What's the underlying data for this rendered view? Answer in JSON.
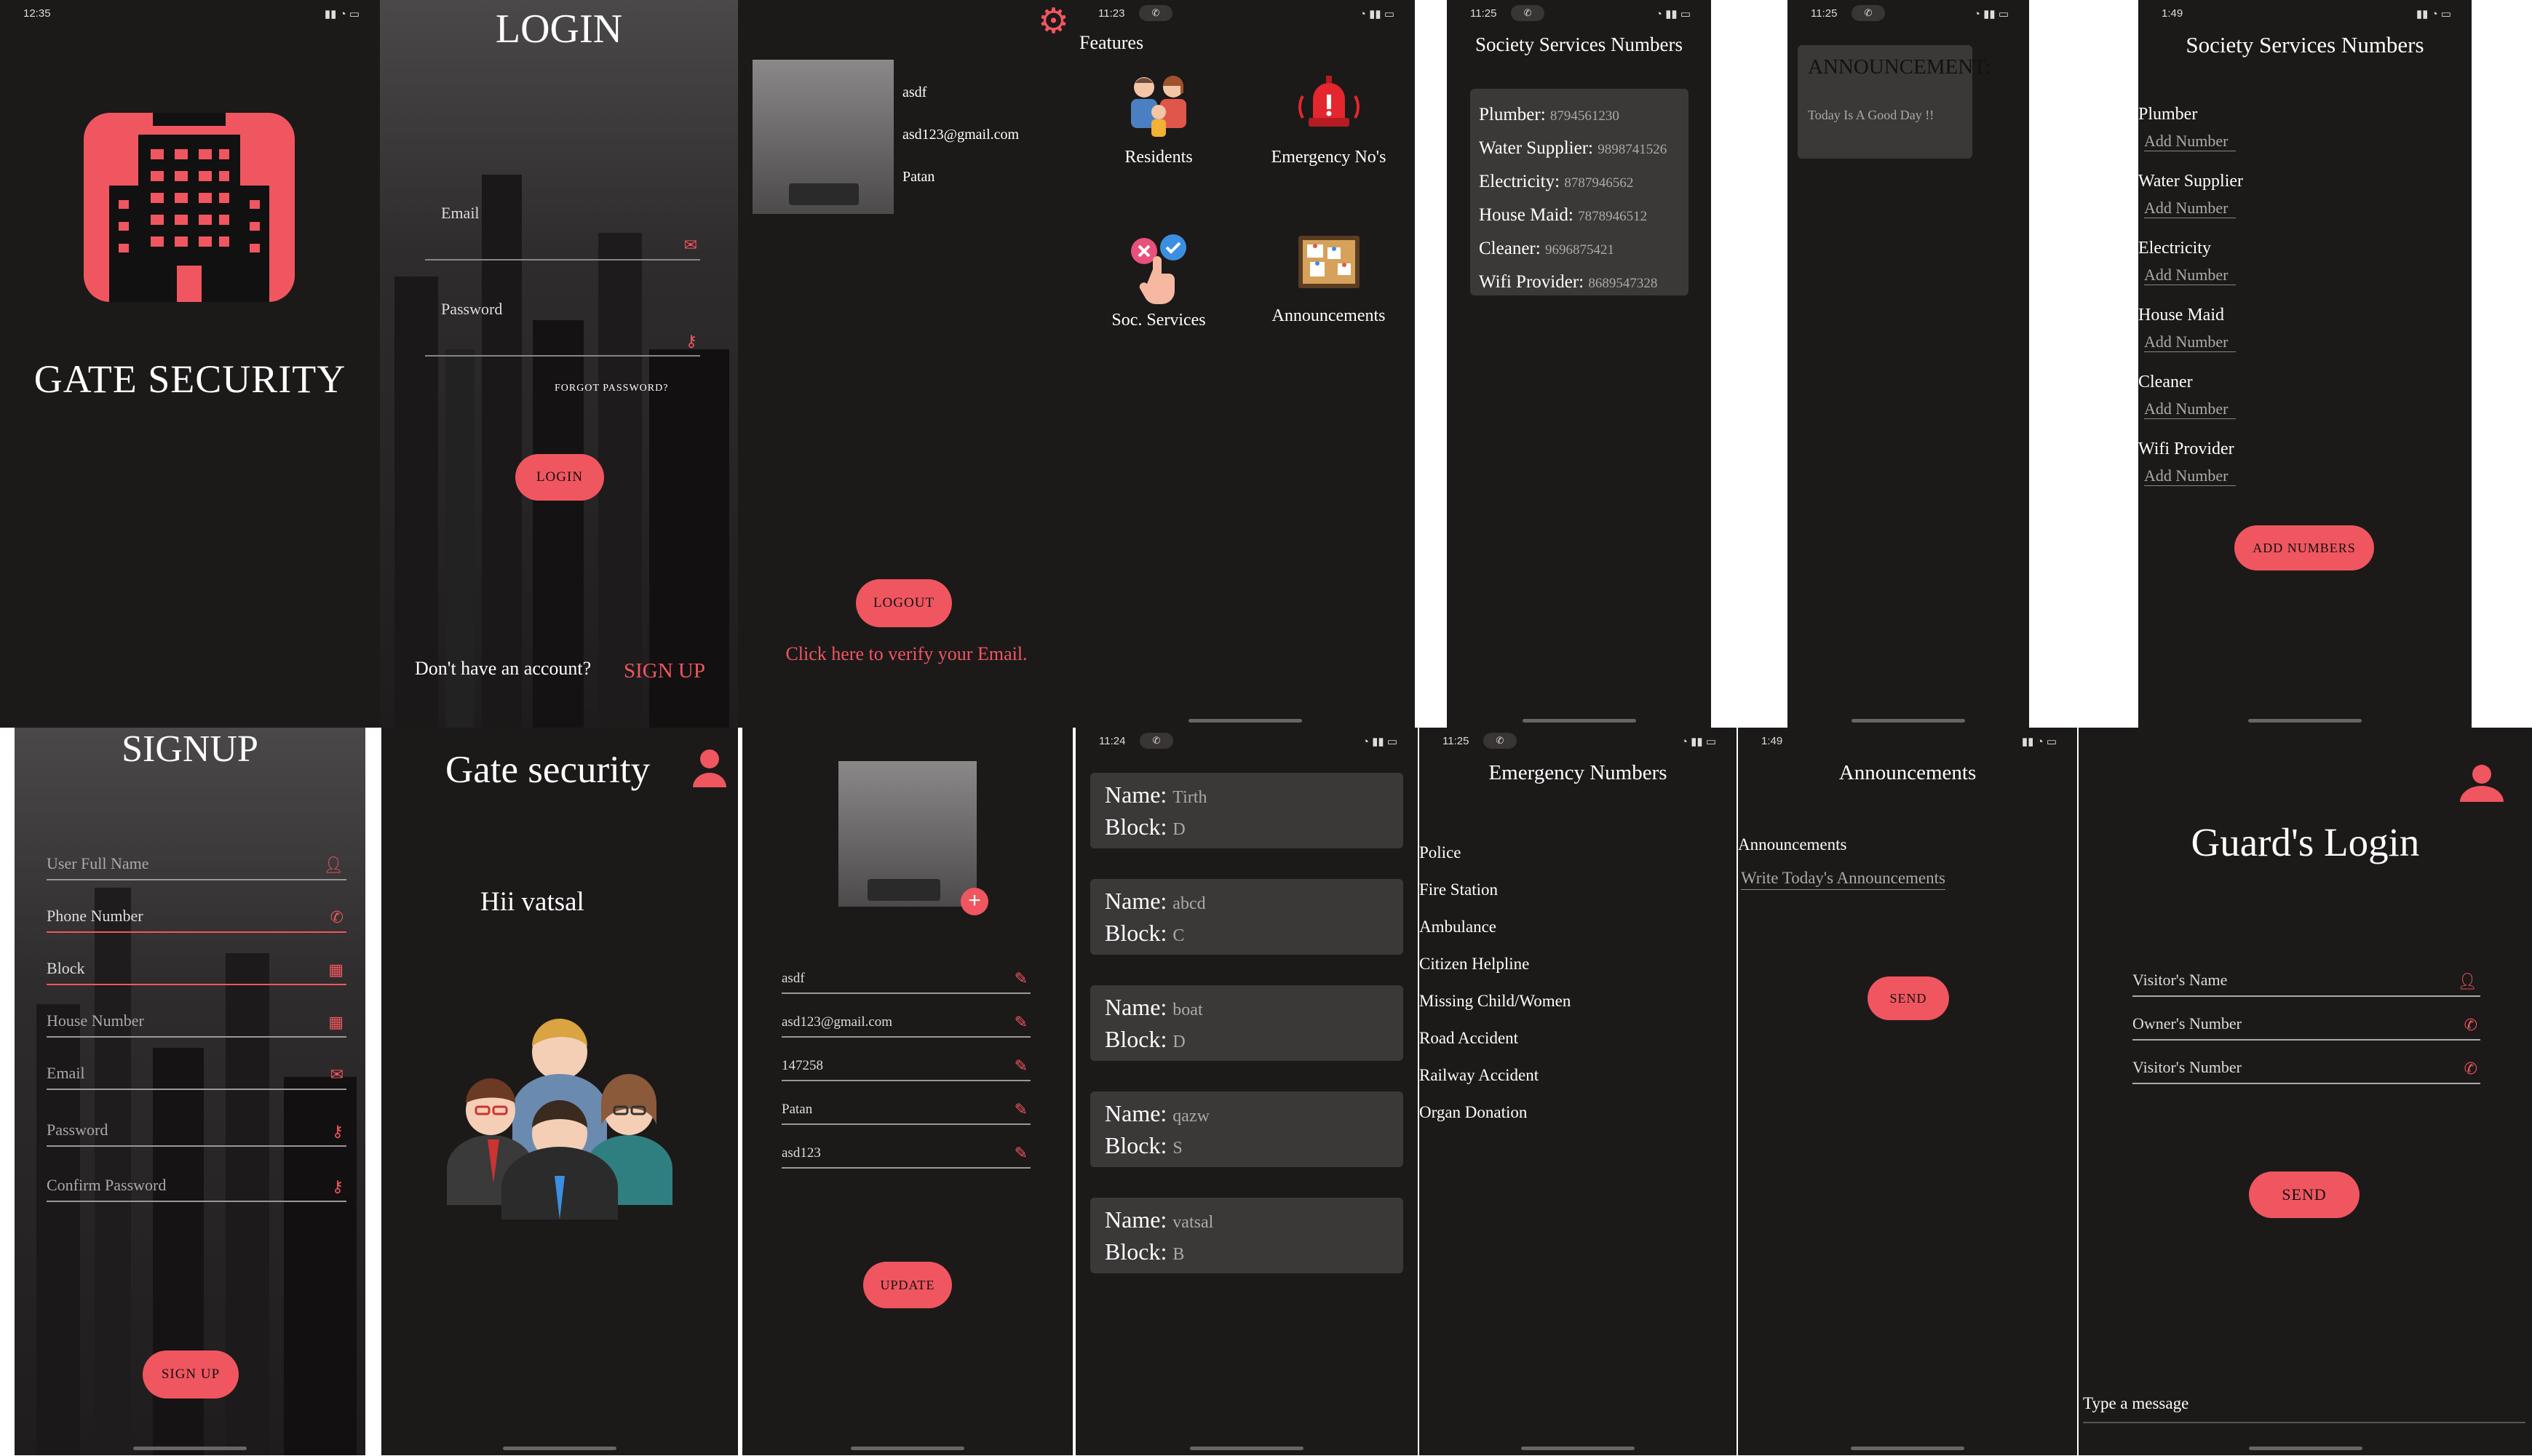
{
  "colors": {
    "accent": "#f05660",
    "panel_bg": "#1c1919",
    "card_bg": "#3b3838"
  },
  "splash": {
    "time": "12:35",
    "title": "GATE SECURITY",
    "logo_icon": "building-icon"
  },
  "login": {
    "title": "LOGIN",
    "email_label": "Email",
    "password_label": "Password",
    "forgot": "FORGOT PASSWORD?",
    "button": "LOGIN",
    "no_account": "Don't have an account?",
    "signup_link": "SIGN UP"
  },
  "profile": {
    "name": "asdf",
    "email": "asd123@gmail.com",
    "city": "Patan",
    "logout": "LOGOUT",
    "verify": "Click here to verify your Email."
  },
  "features": {
    "time": "11:23",
    "header": "Features",
    "items": [
      {
        "label": "Residents",
        "icon": "family-icon"
      },
      {
        "label": "Emergency No's",
        "icon": "alarm-icon"
      },
      {
        "label": "Soc. Services",
        "icon": "choice-icon"
      },
      {
        "label": "Announcements",
        "icon": "board-icon"
      }
    ]
  },
  "services_view": {
    "time": "11:25",
    "title": "Society Services Numbers",
    "rows": [
      {
        "label": "Plumber:",
        "value": "8794561230"
      },
      {
        "label": "Water Supplier:",
        "value": "9898741526"
      },
      {
        "label": "Electricity:",
        "value": "8787946562"
      },
      {
        "label": "House Maid:",
        "value": "7878946512"
      },
      {
        "label": "Cleaner:",
        "value": "9696875421"
      },
      {
        "label": "Wifi Provider:",
        "value": "8689547328"
      }
    ]
  },
  "announcement_view": {
    "time": "11:25",
    "title": "ANNOUNCEMENT:",
    "text": "Today Is A Good Day !!"
  },
  "services_edit": {
    "time": "1:49",
    "title": "Society Services Numbers",
    "items": [
      "Plumber",
      "Water Supplier",
      "Electricity",
      "House Maid",
      "Cleaner",
      "Wifi Provider"
    ],
    "placeholder": "Add Number",
    "button": "ADD NUMBERS"
  },
  "signup": {
    "title": "SIGNUP",
    "fields": [
      {
        "label": "User Full Name",
        "icon": "person-icon"
      },
      {
        "label": "Phone Number",
        "icon": "phone-icon"
      },
      {
        "label": "Block",
        "icon": "building-small-icon"
      },
      {
        "label": "House Number",
        "icon": "building-small-icon"
      },
      {
        "label": "Email",
        "icon": "mail-icon"
      },
      {
        "label": "Password",
        "icon": "key-icon"
      },
      {
        "label": "Confirm Password",
        "icon": "key-icon"
      }
    ],
    "button": "SIGN UP"
  },
  "home": {
    "title": "Gate security",
    "greeting": "Hii vatsal"
  },
  "edit_profile": {
    "fields": [
      "asdf",
      "asd123@gmail.com",
      "147258",
      "Patan",
      "asd123"
    ],
    "button": "UPDATE"
  },
  "residents": {
    "time": "11:24",
    "name_label": "Name:",
    "block_label": "Block:",
    "rows": [
      {
        "name": "Tirth",
        "block": "D"
      },
      {
        "name": "abcd",
        "block": "C"
      },
      {
        "name": "boat",
        "block": "D"
      },
      {
        "name": "qazw",
        "block": "S"
      },
      {
        "name": "vatsal",
        "block": "B"
      }
    ]
  },
  "emergency": {
    "time": "11:25",
    "title": "Emergency Numbers",
    "items": [
      "Police",
      "Fire Station",
      "Ambulance",
      "Citizen Helpline",
      "Missing Child/Women",
      "Road Accident",
      "Railway Accident",
      "Organ Donation"
    ]
  },
  "announce_edit": {
    "time": "1:49",
    "title": "Announcements",
    "label": "Announcements",
    "placeholder": "Write Today's Announcements",
    "button": "SEND"
  },
  "guard": {
    "title": "Guard's Login",
    "fields": [
      {
        "label": "Visitor's Name",
        "icon": "person-icon"
      },
      {
        "label": "Owner's Number",
        "icon": "phone-icon"
      },
      {
        "label": "Visitor's Number",
        "icon": "phone-icon"
      }
    ],
    "button": "SEND",
    "message_placeholder": "Type a message"
  }
}
